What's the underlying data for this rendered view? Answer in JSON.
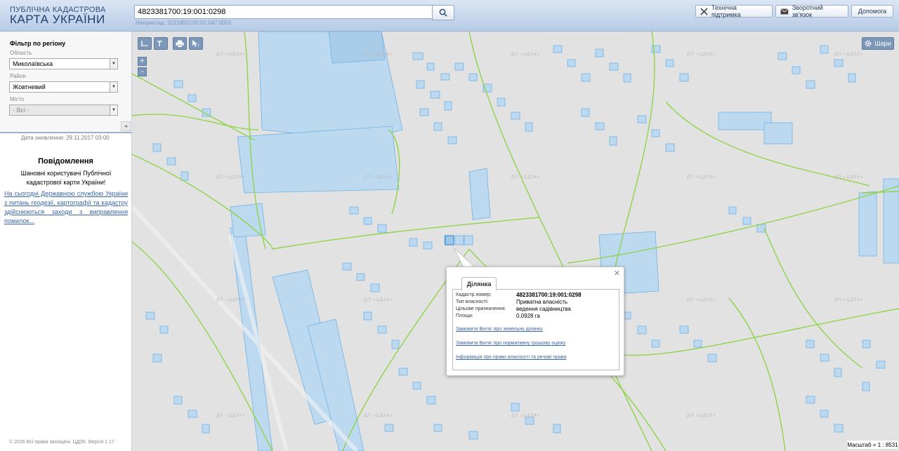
{
  "header": {
    "brand_top": "ПУБЛІЧНА КАДАСТРОВА",
    "brand_main": "КАРТА УКРАЇНИ",
    "search_value": "4823381700:19:001:0298",
    "search_hint": "Наприклад: 3221855100:01:047:0052",
    "buttons": {
      "support": "Технічна підтримка",
      "feedback": "Зворотний зв'язок",
      "help": "Допомога"
    }
  },
  "sidebar": {
    "filter_title": "Фільтр по регіону",
    "oblast_label": "Область",
    "oblast_value": "Миколаївська",
    "raion_label": "Район",
    "raion_value": "Жовтневий",
    "city_label": "Місто",
    "city_value": "- Всі -",
    "updated": "Дата оновлення: 29.11.2017 03:00",
    "notice_title": "Повідомлення",
    "notice_text": "Шановні користувачі Публічної кадастрової карти України!",
    "notice_link": "На сьогодні Державною службою України з питань геодезії, картографії та кадастру здійснюються заходи з виправлення помилок...",
    "copyright": "© 2016 Всі права захищені. ЦДЗК. Версія 1.17"
  },
  "map": {
    "layers_label": "Шари",
    "zoom_in": "+",
    "zoom_out": "-",
    "scale": "Масштаб = 1 : 8531",
    "watermark": "ДП «ЦДЗК»"
  },
  "popup": {
    "tab": "Ділянка",
    "fields": [
      {
        "label": "Кадастр.номер:",
        "value": "4823381700:19:001:0298"
      },
      {
        "label": "Тип власності:",
        "value": "Приватна власність"
      },
      {
        "label": "Цільове призначення:",
        "value": "ведення садівництва"
      },
      {
        "label": "Площа:",
        "value": "0.0928 га"
      }
    ],
    "links": [
      "Замовити Витяг про земельну ділянку",
      "Замовити Витяг про нормативну грошову оцінку",
      "Інформація про право власності та речові права"
    ]
  },
  "colors": {
    "parcel_fill": "#bcd9ef",
    "parcel_stroke": "#6fb3e6",
    "boundary": "#8ed44a",
    "map_bg": "#e2e2e2"
  }
}
